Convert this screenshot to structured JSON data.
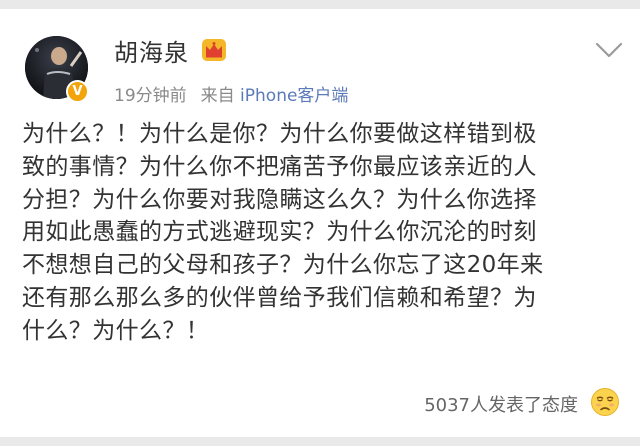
{
  "post": {
    "author": "胡海泉",
    "time": "19分钟前",
    "source_prefix": "来自",
    "source": "iPhone客户端",
    "verified_mark": "V",
    "text": "为什么？！为什么是你？为什么你要做这样错到极\n致的事情？为什么你不把痛苦予你最应该亲近的人\n分担？为什么你要对我隐瞒这么久？为什么你选择\n用如此愚蠢的方式逃避现实？为什么你沉沦的时刻\n不想想自己的父母和孩子？为什么你忘了这20年来\n还有那么那么多的伙伴曾给予我们信赖和希望？为\n什么？为什么？！",
    "reactions": "5037人发表了态度"
  },
  "icons": {
    "avatar": "avatar-photo",
    "verified": "verified-badge-icon",
    "crown": "crown-icon",
    "menu": "chevron-down-icon",
    "reaction": "sad-face-emoji-icon"
  },
  "colors": {
    "accent_blue": "#5b7ab8",
    "verified_gold": "#f2a40a",
    "crown_red": "#e0402f",
    "text": "#333333",
    "meta_gray": "#8a8a8a"
  }
}
